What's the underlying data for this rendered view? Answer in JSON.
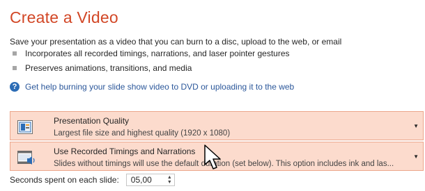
{
  "header": {
    "title": "Create a Video",
    "description": "Save your presentation as a video that you can burn to a disc, upload to the web, or email"
  },
  "bullets": [
    "Incorporates all recorded timings, narrations, and laser pointer gestures",
    "Preserves animations, transitions, and media"
  ],
  "help_link": {
    "text": "Get help burning your slide show video to DVD or uploading it to the web",
    "icon": "question-circle-icon"
  },
  "quality_dropdown": {
    "label": "Presentation Quality",
    "description": "Largest file size and highest quality (1920 x 1080)",
    "icon": "presentation-quality-icon"
  },
  "timings_dropdown": {
    "label": "Use Recorded Timings and Narrations",
    "description": "Slides without timings will use the default duration (set below). This option includes ink and las...",
    "icon": "film-speaker-icon"
  },
  "seconds_field": {
    "label": "Seconds spent on each slide:",
    "value": "05,00"
  },
  "colors": {
    "accent": "#d24726",
    "dropdown_bg": "#fcdbcd",
    "dropdown_border": "#eba68b",
    "link": "#2b579a"
  }
}
